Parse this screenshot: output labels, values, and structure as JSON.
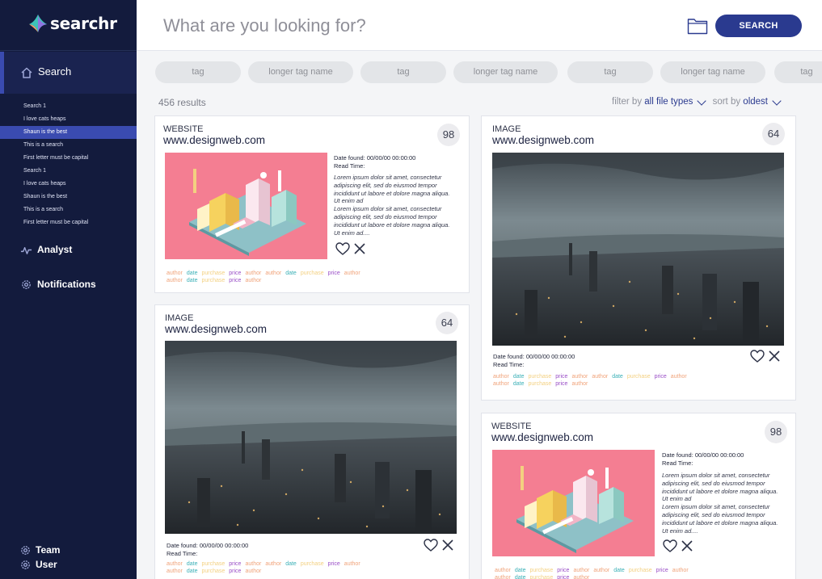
{
  "app": {
    "logo_text": "searchr"
  },
  "sidebar": {
    "search_label": "Search",
    "history": [
      "Search 1",
      "I love cats heaps",
      "Shaun is the best",
      "This is a search",
      "First letter must be capital",
      "Search 1",
      "I love cats heaps",
      "Shaun is the best",
      "This is a search",
      "First letter must be capital"
    ],
    "active_history_index": 2,
    "analyst_label": "Analyst",
    "notifications_label": "Notifications",
    "team_label": "Team",
    "user_label": "User"
  },
  "topbar": {
    "search_placeholder": "What are you looking for?",
    "search_button": "SEARCH"
  },
  "tags": [
    "tag",
    "longer tag name",
    "tag",
    "longer tag name",
    "tag",
    "longer tag name",
    "tag"
  ],
  "results": {
    "count_text": "456 results",
    "filter_prefix": "filter by",
    "filter_value": "all file types",
    "sort_prefix": "sort by",
    "sort_value": "oldest"
  },
  "cards": [
    {
      "type": "WEBSITE",
      "url": "www.designweb.com",
      "score": "98",
      "date_found": "Date found: 00/00/00 00:00:00",
      "read_time": "Read Time:",
      "desc1": "Lorem ipsum dolor sit amet, consectetur adipiscing elit, sed do eiusmod tempor incididunt ut labore et dolore magna aliqua. Ut enim ad",
      "desc2": "Lorem ipsum dolor sit amet, consectetur adipiscing elit, sed do eiusmod tempor incididunt ut labore et dolore magna aliqua. Ut enim ad....",
      "chips_row1": [
        "author",
        "date",
        "purchase",
        "price",
        "author",
        "author",
        "date",
        "purchase",
        "price",
        "author"
      ],
      "chips_row2": [
        "author",
        "date",
        "purchase",
        "price",
        "author"
      ]
    },
    {
      "type": "IMAGE",
      "url": "www.designweb.com",
      "score": "64",
      "date_found": "Date found: 00/00/00 00:00:00",
      "read_time": "Read Time:",
      "chips_row1": [
        "author",
        "date",
        "purchase",
        "price",
        "author",
        "author",
        "date",
        "purchase",
        "price",
        "author"
      ],
      "chips_row2": [
        "author",
        "date",
        "purchase",
        "price",
        "author"
      ]
    },
    {
      "type": "IMAGE",
      "url": "www.designweb.com",
      "score": "64",
      "date_found": "Date found: 00/00/00 00:00:00",
      "read_time": "Read Time:",
      "chips_row1": [
        "author",
        "date",
        "purchase",
        "price",
        "author",
        "author",
        "date",
        "purchase",
        "price",
        "author"
      ],
      "chips_row2": [
        "author",
        "date",
        "purchase",
        "price",
        "author"
      ]
    },
    {
      "type": "WEBSITE",
      "url": "www.designweb.com",
      "score": "98",
      "date_found": "Date found: 00/00/00 00:00:00",
      "read_time": "Read Time:",
      "desc1": "Lorem ipsum dolor sit amet, consectetur adipiscing elit, sed do eiusmod tempor incididunt ut labore et dolore magna aliqua. Ut enim ad",
      "desc2": "Lorem ipsum dolor sit amet, consectetur adipiscing elit, sed do eiusmod tempor incididunt ut labore et dolore magna aliqua. Ut enim ad....",
      "chips_row1": [
        "author",
        "date",
        "purchase",
        "price",
        "author",
        "author",
        "date",
        "purchase",
        "price",
        "author"
      ],
      "chips_row2": [
        "author",
        "date",
        "purchase",
        "price",
        "author"
      ]
    }
  ],
  "colors": {
    "sidebar_bg": "#131b3d",
    "accent": "#2a3a8f",
    "author": "#f0a37a",
    "date": "#3ab0b7",
    "purchase": "#f3d080",
    "price": "#9a4fc7"
  },
  "icons": [
    "home-icon",
    "pulse-icon",
    "gear-icon",
    "folder-icon",
    "heart-icon",
    "close-icon",
    "chevron-down-icon"
  ]
}
